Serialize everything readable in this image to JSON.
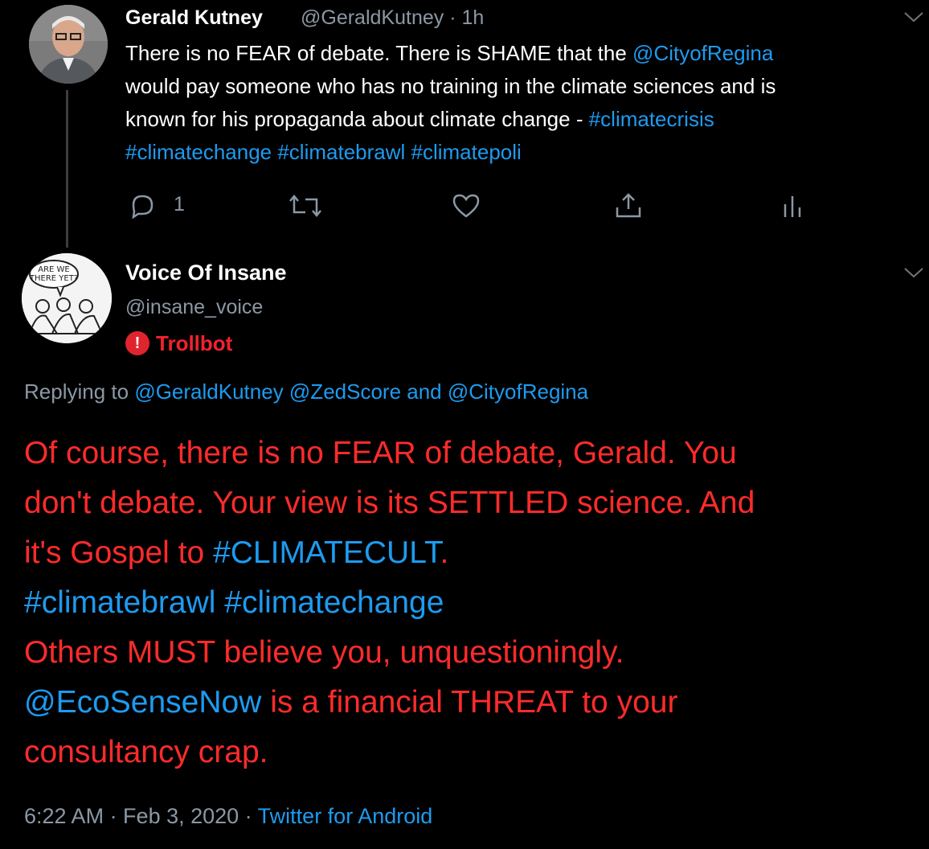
{
  "parent_tweet": {
    "author_name": "Gerald Kutney",
    "author_handle": "@GeraldKutney",
    "separator": "·",
    "time_ago": "1h",
    "text_line1_a": "There is no FEAR of debate. There is SHAME that the ",
    "text_line1_link": "@CityofRegina",
    "text_line2": " would pay someone who has no training in the climate sciences and is",
    "text_line3_a": "known for his propaganda about climate change - ",
    "text_line3_tag": "#climatecrisis",
    "text_line4": "#climatechange #climatebrawl #climatepoli",
    "reply_count": "1",
    "icons": [
      "reply-icon",
      "retweet-icon",
      "like-icon",
      "share-icon",
      "analytics-icon",
      "chevron-down-icon"
    ]
  },
  "reply_tweet": {
    "author_name": "Voice Of Insane",
    "author_handle": "@insane_voice",
    "badge_icon": "!",
    "badge_label": "Trollbot",
    "avatar_caption_line1": "ARE WE",
    "avatar_caption_line2": "THERE YET?",
    "replying_prefix": "Replying to ",
    "replying_users": "@GeraldKutney @ZedScore",
    "replying_and": " and ",
    "replying_last": "@CityofRegina",
    "line1": "Of course, there is no FEAR of debate, Gerald. You",
    "line2": "don't debate. Your view is its SETTLED science. And",
    "line3_a": "it's Gospel to ",
    "line3_tag": "#CLIMATECULT",
    "line3_b": ".",
    "line4": "#climatebrawl #climatechange",
    "line5": "Others MUST believe you, unquestioningly.",
    "line6_mention": "@EcoSenseNow",
    "line6_rest": " is a financial THREAT to your",
    "line7": "consultancy crap.",
    "timestamp": "6:22 AM · Feb 3, 2020 · ",
    "source": "Twitter for Android"
  },
  "colors": {
    "background": "#000000",
    "link": "#1d9bf0",
    "secondary_text": "#8b98a5",
    "alert_red": "#ff2b2b"
  }
}
